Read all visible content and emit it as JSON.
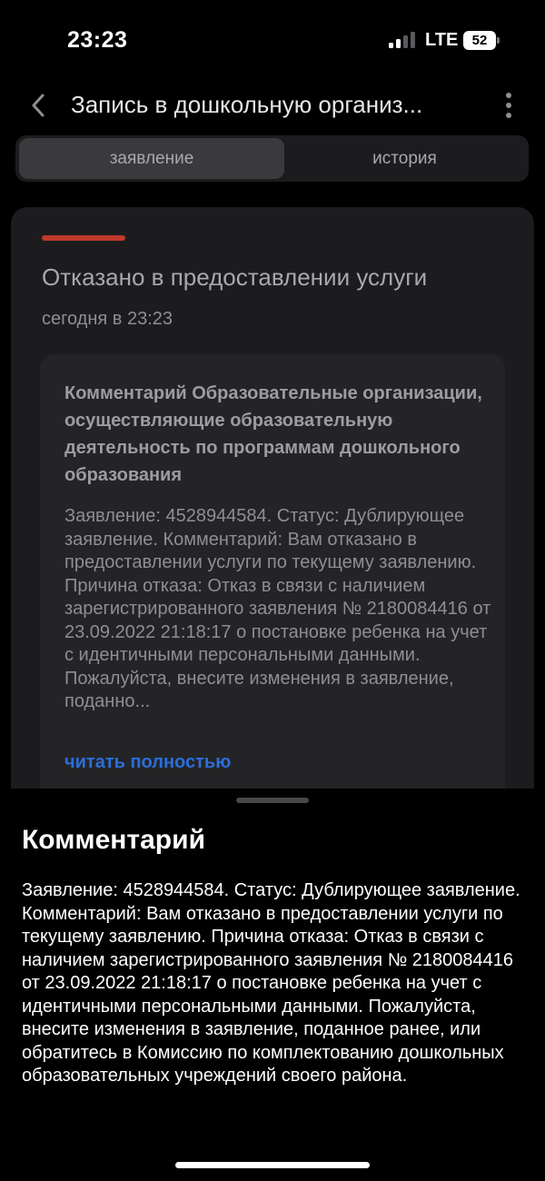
{
  "status_bar": {
    "time": "23:23",
    "network": "LTE",
    "battery": "52",
    "signal_bars_active": 2,
    "signal_bars_total": 4
  },
  "nav": {
    "title": "Запись в дошкольную организ...",
    "back_icon": "chevron-left-icon",
    "more_icon": "more-vertical-icon"
  },
  "tabs": [
    {
      "label": "заявление",
      "selected": true
    },
    {
      "label": "история",
      "selected": false
    }
  ],
  "card": {
    "status_color": "#c0392b",
    "status_title": "Отказано в предоставлении услуги",
    "date": "сегодня в 23:23",
    "comment_heading": "Комментарий Образовательные организации, осуществляющие образовательную деятельность по программам дошкольного образования",
    "comment_preview": "Заявление: 4528944584. Статус: Дублирующее заявление. Комментарий: Вам отказано в предоставлении услуги по текущему заявлению. Причина отказа: Отказ в связи с наличием зарегистрированного заявления № 2180084416 от 23.09.2022 21:18:17 о постановке ребенка на учет с идентичными персональными данными. Пожалуйста, внесите изменения в заявление, поданно...",
    "read_more": "читать полностью"
  },
  "sheet": {
    "title": "Комментарий",
    "body": "Заявление: 4528944584. Статус: Дублирующее заявление. Комментарий: Вам отказано в предоставлении услуги по текущему заявлению. Причина отказа: Отказ в связи с наличием зарегистрированного заявления № 2180084416 от 23.09.2022 21:18:17 о постановке ребенка на учет с идентичными персональными данными. Пожалуйста, внесите изменения в заявление, поданное ранее, или обратитесь в Комиссию по комплектованию дошкольных образовательных учреждений своего района."
  },
  "colors": {
    "background": "#000000",
    "card": "#1c1c1e",
    "link": "#2a6fdb",
    "rejected": "#c0392b"
  }
}
